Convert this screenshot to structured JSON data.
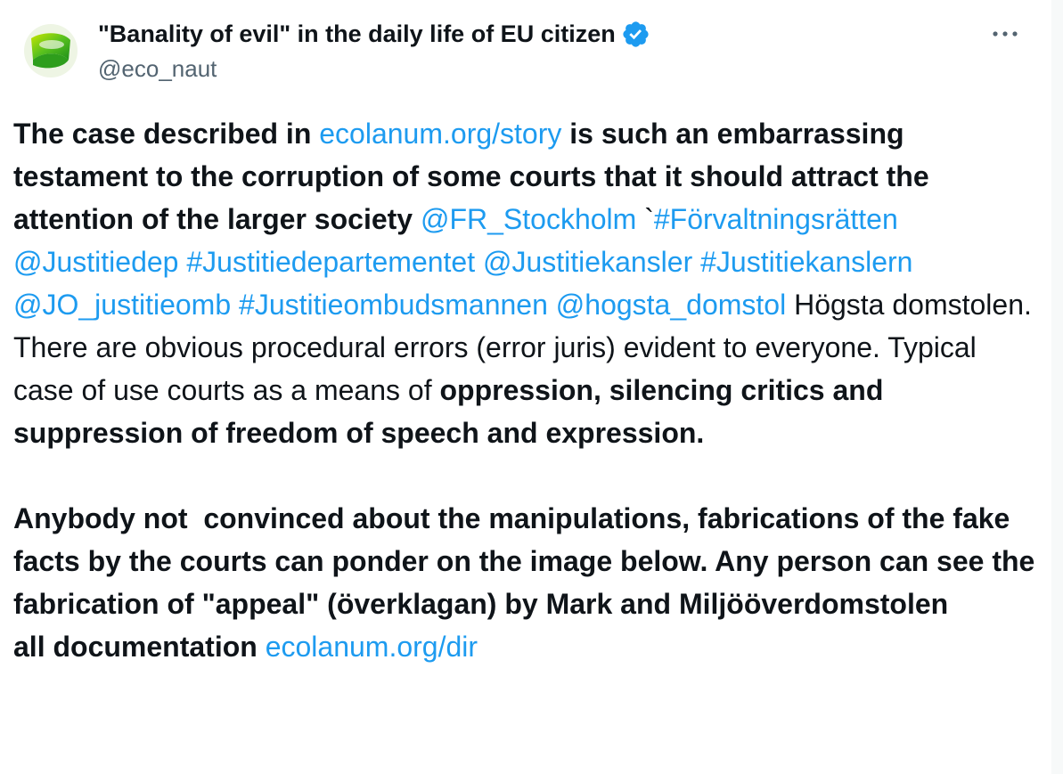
{
  "author": {
    "display_name": "\"Banality of evil\" in the daily life of EU citizen",
    "handle": "@eco_naut",
    "verified": true,
    "avatar_icon": "green-ring-logo-icon"
  },
  "menu": {
    "more_icon": "more-options-icon"
  },
  "colors": {
    "link": "#1d9bf0",
    "text": "#0f1419",
    "muted": "#536471",
    "verified": "#1d9bf0"
  },
  "tweet": {
    "segments": [
      {
        "t": "bold",
        "text": "The case described in "
      },
      {
        "t": "link",
        "text": "ecolanum.org/story"
      },
      {
        "t": "bold",
        "text": " is such an embarrassing testament to the corruption of some courts that it should attract the attention of the larger society "
      },
      {
        "t": "link",
        "text": "@FR_Stockholm"
      },
      {
        "t": "plain",
        "text": " `"
      },
      {
        "t": "link",
        "text": "#Förvaltningsrätten"
      },
      {
        "t": "plain",
        "text": " "
      },
      {
        "t": "link",
        "text": "@Justitiedep"
      },
      {
        "t": "plain",
        "text": " "
      },
      {
        "t": "link",
        "text": "#Justitiedepartementet"
      },
      {
        "t": "plain",
        "text": " "
      },
      {
        "t": "link",
        "text": "@Justitiekansler"
      },
      {
        "t": "plain",
        "text": " "
      },
      {
        "t": "link",
        "text": "#Justitiekanslern"
      },
      {
        "t": "plain",
        "text": " "
      },
      {
        "t": "link",
        "text": "@JO_justitieomb"
      },
      {
        "t": "plain",
        "text": " "
      },
      {
        "t": "link",
        "text": "#Justitieombudsmannen"
      },
      {
        "t": "plain",
        "text": " "
      },
      {
        "t": "link",
        "text": "@hogsta_domstol"
      },
      {
        "t": "plain",
        "text": " Högsta domstolen. There are obvious procedural errors (error juris) evident to everyone. Typical case of use courts as a means of "
      },
      {
        "t": "bold",
        "text": "oppression, silencing critics and suppression of freedom of speech and expression.\n\nAnybody not  convinced about the manipulations, fabrications of the fake facts by the courts can ponder on the image below. Any person can see the fabrication of \"appeal\" (överklagan) by Mark and Miljööverdomstolen\nall documentation "
      },
      {
        "t": "link",
        "text": "ecolanum.org/dir"
      }
    ]
  }
}
